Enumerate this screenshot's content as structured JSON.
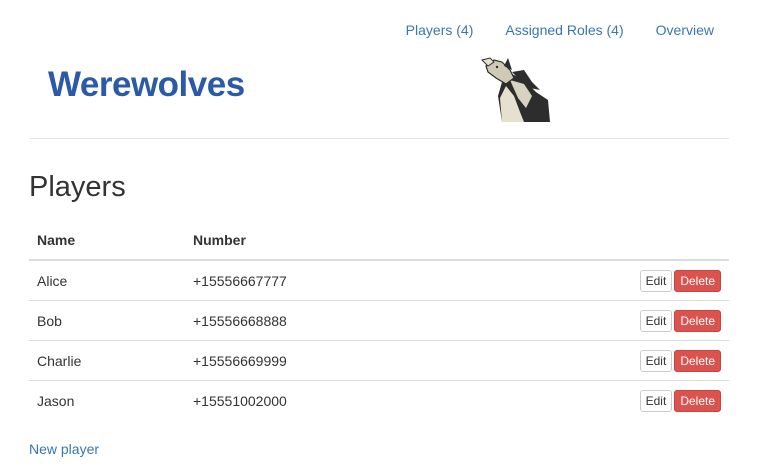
{
  "nav": {
    "items": [
      {
        "label": "Players (4)"
      },
      {
        "label": "Assigned Roles (4)"
      },
      {
        "label": "Overview"
      }
    ]
  },
  "brand": {
    "title": "Werewolves",
    "logo_icon": "howling-wolf-icon"
  },
  "main": {
    "title": "Players",
    "table": {
      "headers": [
        "Name",
        "Number",
        ""
      ],
      "rows": [
        {
          "name": "Alice",
          "number": "+15556667777"
        },
        {
          "name": "Bob",
          "number": "+15556668888"
        },
        {
          "name": "Charlie",
          "number": "+15556669999"
        },
        {
          "name": "Jason",
          "number": "+15551002000"
        }
      ],
      "edit_label": "Edit",
      "delete_label": "Delete"
    },
    "new_player_label": "New player"
  },
  "colors": {
    "link": "#3a76b0",
    "brand": "#2a5aa8",
    "danger": "#d9534f"
  }
}
